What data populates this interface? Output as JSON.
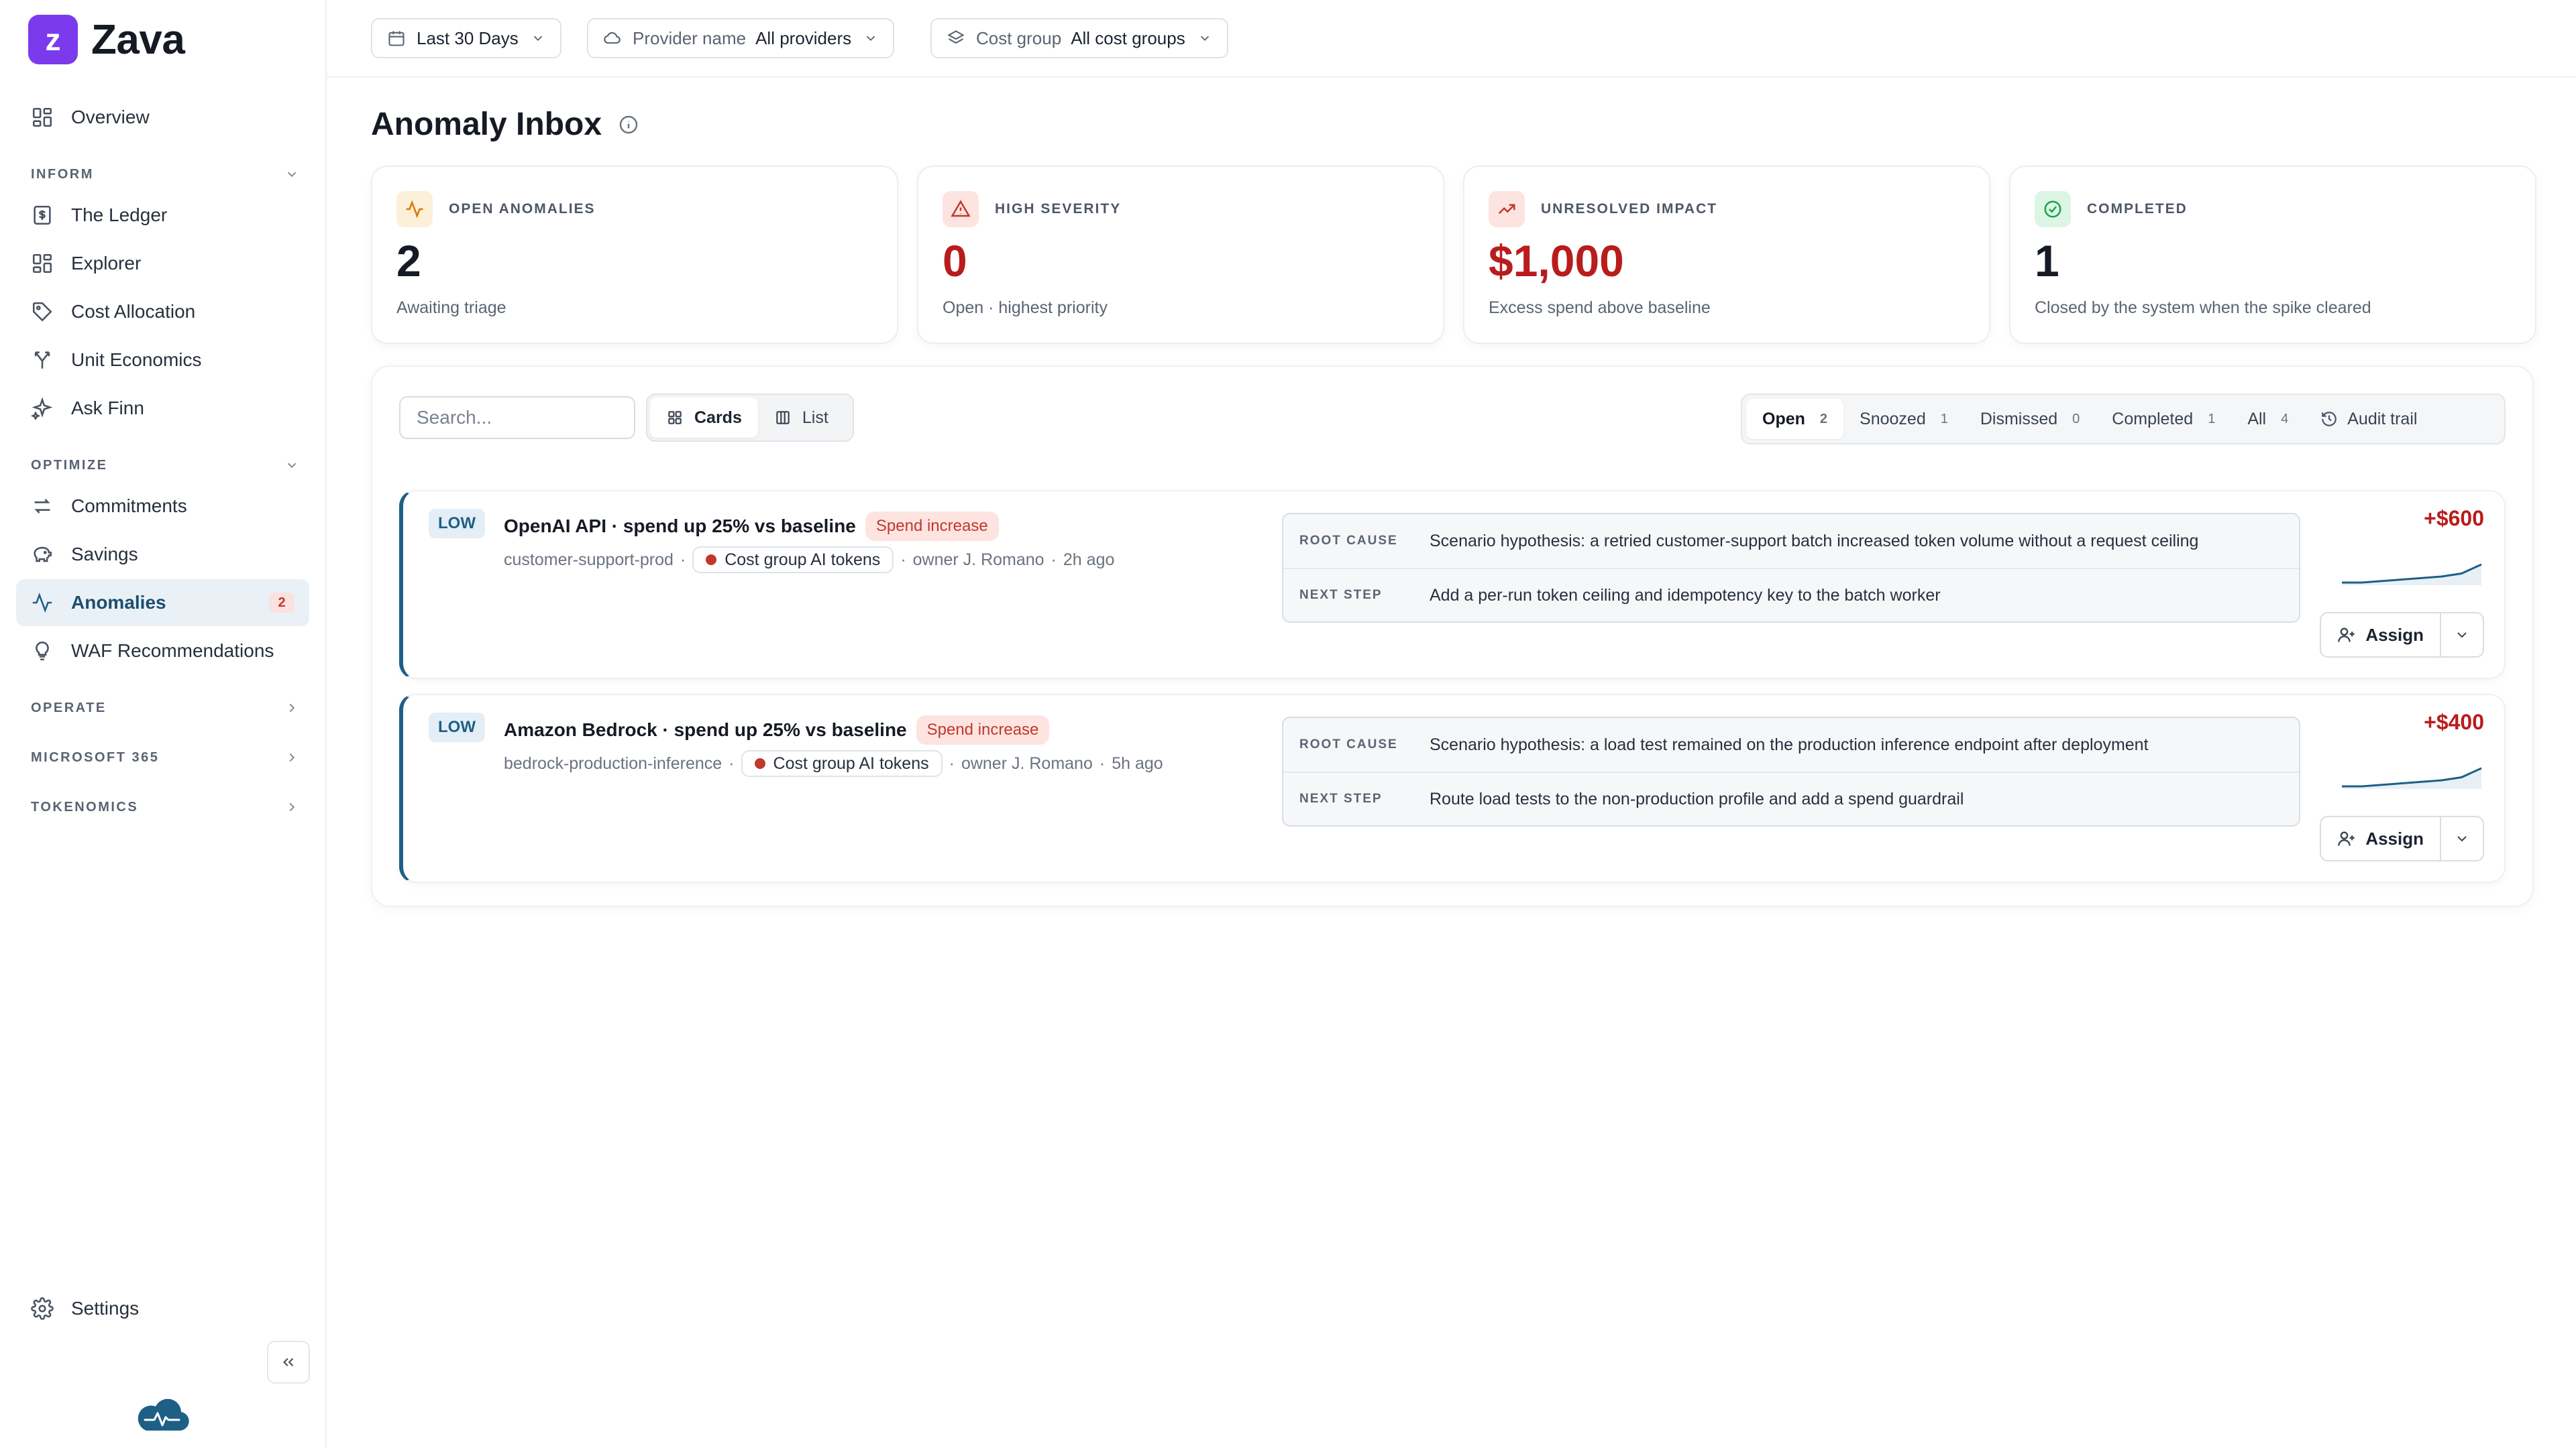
{
  "brand": {
    "logo_letter": "z",
    "name": "Zava"
  },
  "sidebar": {
    "top_item": {
      "label": "Overview",
      "icon": "grid-icon"
    },
    "sections": [
      {
        "label": "INFORM",
        "expanded": true,
        "items": [
          {
            "label": "The Ledger",
            "icon": "ledger-icon"
          },
          {
            "label": "Explorer",
            "icon": "grid-icon"
          },
          {
            "label": "Cost Allocation",
            "icon": "tag-icon"
          },
          {
            "label": "Unit Economics",
            "icon": "split-icon"
          },
          {
            "label": "Ask Finn",
            "icon": "sparkle-icon"
          }
        ]
      },
      {
        "label": "OPTIMIZE",
        "expanded": true,
        "items": [
          {
            "label": "Commitments",
            "icon": "arrows-icon"
          },
          {
            "label": "Savings",
            "icon": "piggy-bank-icon"
          },
          {
            "label": "Anomalies",
            "icon": "pulse-icon",
            "active": true,
            "badge": "2"
          },
          {
            "label": "WAF Recommendations",
            "icon": "lightbulb-icon"
          }
        ]
      },
      {
        "label": "OPERATE",
        "expanded": false
      },
      {
        "label": "MICROSOFT 365",
        "expanded": false
      },
      {
        "label": "TOKENOMICS",
        "expanded": false
      }
    ],
    "settings_label": "Settings"
  },
  "filters": {
    "date": {
      "value": "Last 30 Days"
    },
    "provider": {
      "label": "Provider name",
      "value": "All providers"
    },
    "cost_group": {
      "label": "Cost group",
      "value": "All cost groups"
    }
  },
  "page": {
    "title": "Anomaly Inbox"
  },
  "stats": [
    {
      "label": "OPEN ANOMALIES",
      "value": "2",
      "sub": "Awaiting triage",
      "icon": "pulse-icon",
      "accent": "#d97706"
    },
    {
      "label": "HIGH SEVERITY",
      "value": "0",
      "sub": "Open · highest priority",
      "icon": "warning-icon",
      "accent": "#c0392b"
    },
    {
      "label": "UNRESOLVED IMPACT",
      "value": "$1,000",
      "sub": "Excess spend above baseline",
      "icon": "trend-up-icon",
      "accent": "#c0392b"
    },
    {
      "label": "COMPLETED",
      "value": "1",
      "sub": "Closed by the system when the spike cleared",
      "icon": "check-circle-icon",
      "accent": "#16a34a"
    }
  ],
  "toolbar": {
    "search_placeholder": "Search...",
    "view_cards": "Cards",
    "view_list": "List",
    "status_tabs": [
      {
        "label": "Open",
        "count": "2",
        "active": true
      },
      {
        "label": "Snoozed",
        "count": "1"
      },
      {
        "label": "Dismissed",
        "count": "0"
      },
      {
        "label": "Completed",
        "count": "1"
      },
      {
        "label": "All",
        "count": "4"
      }
    ],
    "audit_trail": "Audit trail"
  },
  "anomalies": [
    {
      "severity": "LOW",
      "title": "OpenAI API · spend up 25% vs baseline",
      "tag": "Spend increase",
      "resource": "customer-support-prod",
      "cost_group": "Cost group AI tokens",
      "owner": "owner J. Romano",
      "age": "2h ago",
      "root_cause_label": "ROOT CAUSE",
      "root_cause": "Scenario hypothesis: a retried customer-support batch increased token volume without a request ceiling",
      "next_step_label": "NEXT STEP",
      "next_step": "Add a per-run token ceiling and idempotency key to the batch worker",
      "delta": "+$600",
      "assign_label": "Assign",
      "sparkline": [
        10,
        10,
        10.5,
        11,
        11.5,
        12,
        13,
        16
      ]
    },
    {
      "severity": "LOW",
      "title": "Amazon Bedrock · spend up 25% vs baseline",
      "tag": "Spend increase",
      "resource": "bedrock-production-inference",
      "cost_group": "Cost group AI tokens",
      "owner": "owner J. Romano",
      "age": "5h ago",
      "root_cause_label": "ROOT CAUSE",
      "root_cause": "Scenario hypothesis: a load test remained on the production inference endpoint after deployment",
      "next_step_label": "NEXT STEP",
      "next_step": "Route load tests to the non-production profile and add a spend guardrail",
      "delta": "+$400",
      "assign_label": "Assign",
      "sparkline": [
        10,
        10,
        10.5,
        11,
        11.5,
        12,
        13,
        16
      ]
    }
  ],
  "colors": {
    "brand": "#7c3aed",
    "accent": "#1f5f86",
    "danger": "#b91c1c"
  }
}
